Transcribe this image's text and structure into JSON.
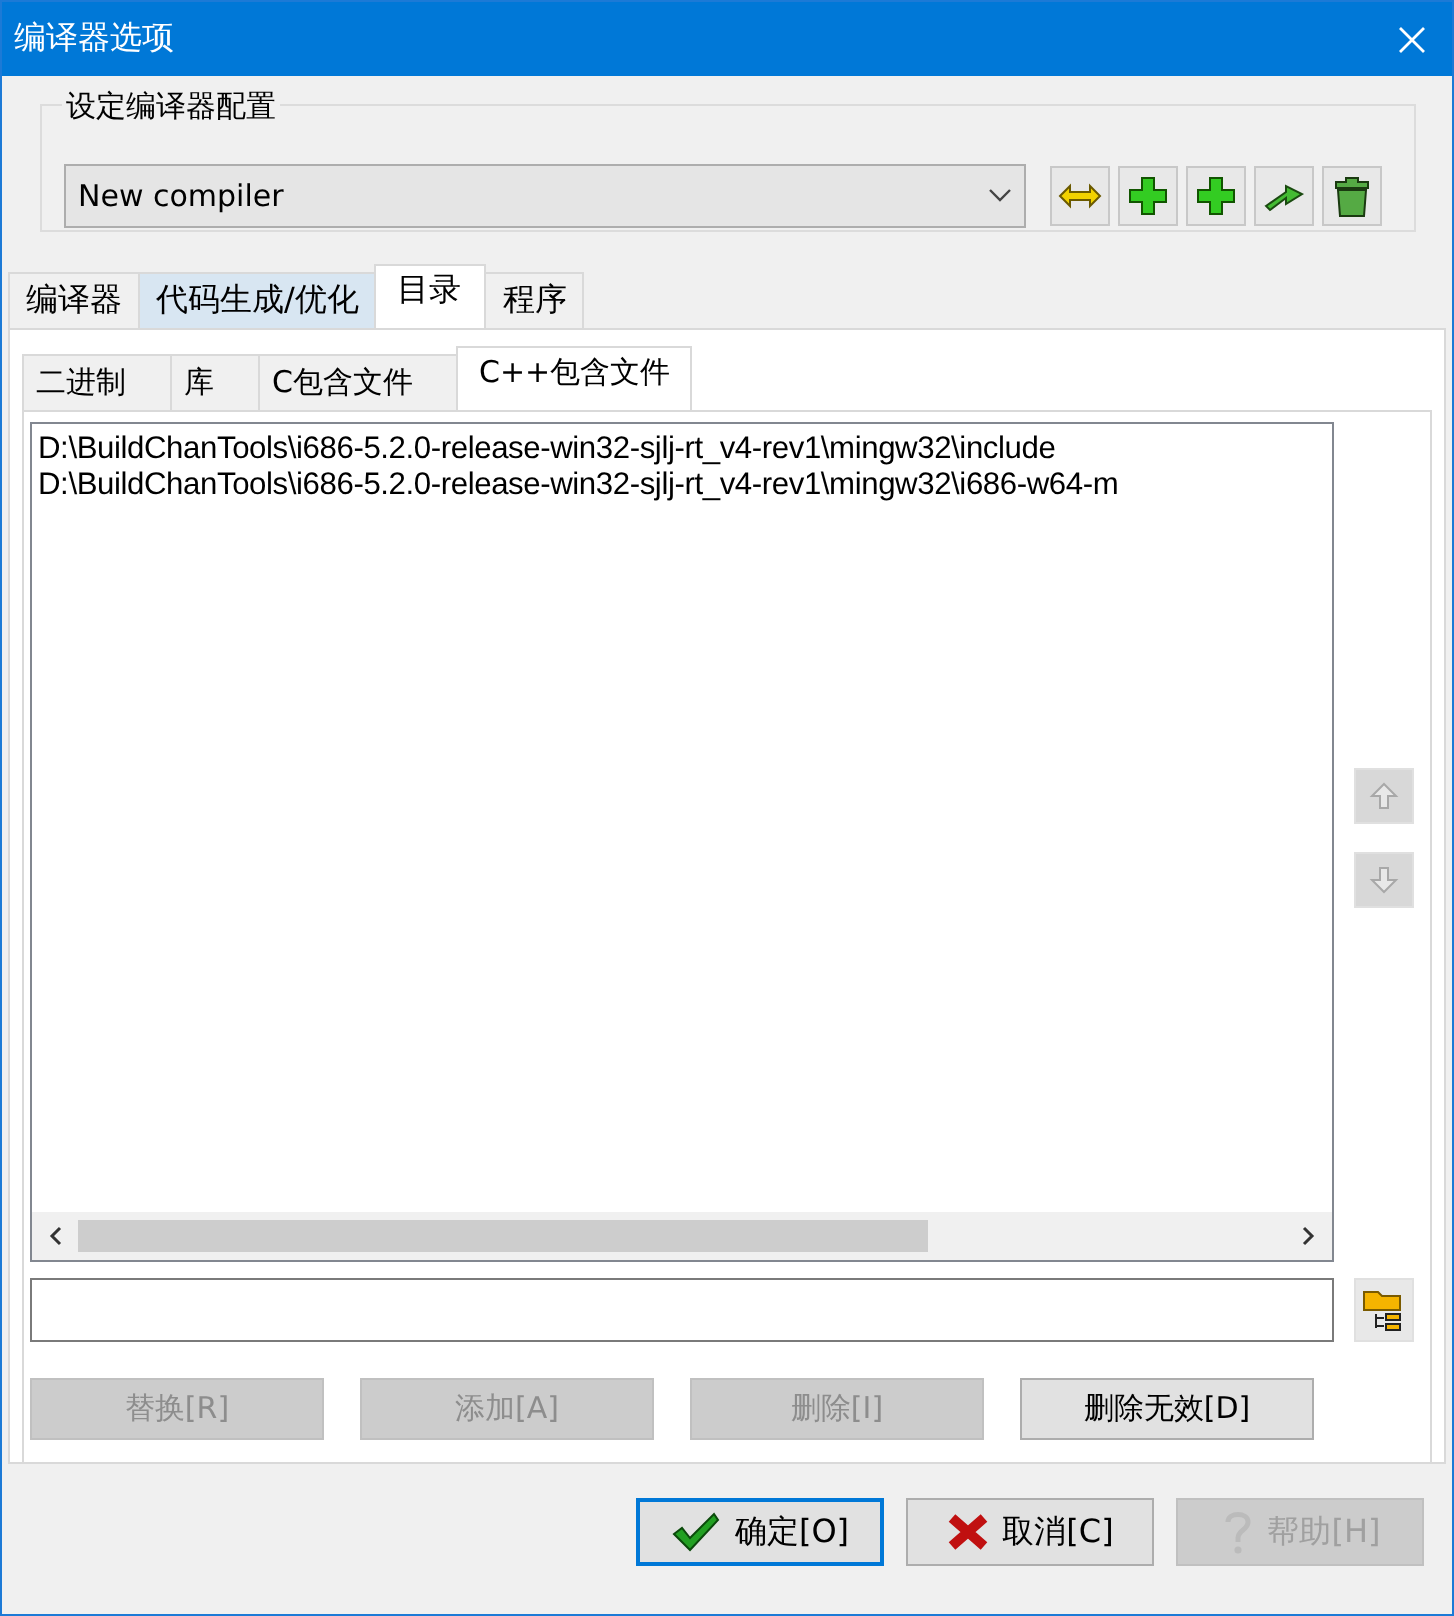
{
  "window": {
    "title": "编译器选项"
  },
  "compiler_set": {
    "label": "设定编译器配置",
    "value": "New compiler",
    "tools": [
      {
        "kind": "rename"
      },
      {
        "kind": "add"
      },
      {
        "kind": "add"
      },
      {
        "kind": "export"
      },
      {
        "kind": "delete"
      }
    ]
  },
  "tabs": [
    {
      "label": "编译器",
      "selected": false,
      "highlighted": false
    },
    {
      "label": "代码生成/优化",
      "selected": false,
      "highlighted": true
    },
    {
      "label": "目录",
      "selected": true,
      "highlighted": false
    },
    {
      "label": "程序",
      "selected": false,
      "highlighted": false
    }
  ],
  "subtabs": [
    {
      "label": "二进制",
      "selected": false
    },
    {
      "label": "库",
      "selected": false
    },
    {
      "label": "C包含文件",
      "selected": false
    },
    {
      "label": "C++包含文件",
      "selected": true
    }
  ],
  "paths": [
    "D:\\BuildChanTools\\i686-5.2.0-release-win32-sjlj-rt_v4-rev1\\mingw32\\include",
    "D:\\BuildChanTools\\i686-5.2.0-release-win32-sjlj-rt_v4-rev1\\mingw32\\i686-w64-m"
  ],
  "move_buttons": [
    {
      "kind": "up",
      "disabled": true
    },
    {
      "kind": "down",
      "disabled": true
    }
  ],
  "actions": [
    {
      "label": "替换[R]",
      "disabled": true
    },
    {
      "label": "添加[A]",
      "disabled": true
    },
    {
      "label": "删除[I]",
      "disabled": true
    },
    {
      "label": "删除无效[D]",
      "disabled": false
    }
  ],
  "dialog_buttons": [
    {
      "kind": "ok",
      "label": "确定[O]",
      "disabled": false,
      "default": true
    },
    {
      "kind": "cancel",
      "label": "取消[C]",
      "disabled": false,
      "default": false
    },
    {
      "kind": "help",
      "label": "帮助[H]",
      "disabled": true,
      "default": false
    }
  ]
}
